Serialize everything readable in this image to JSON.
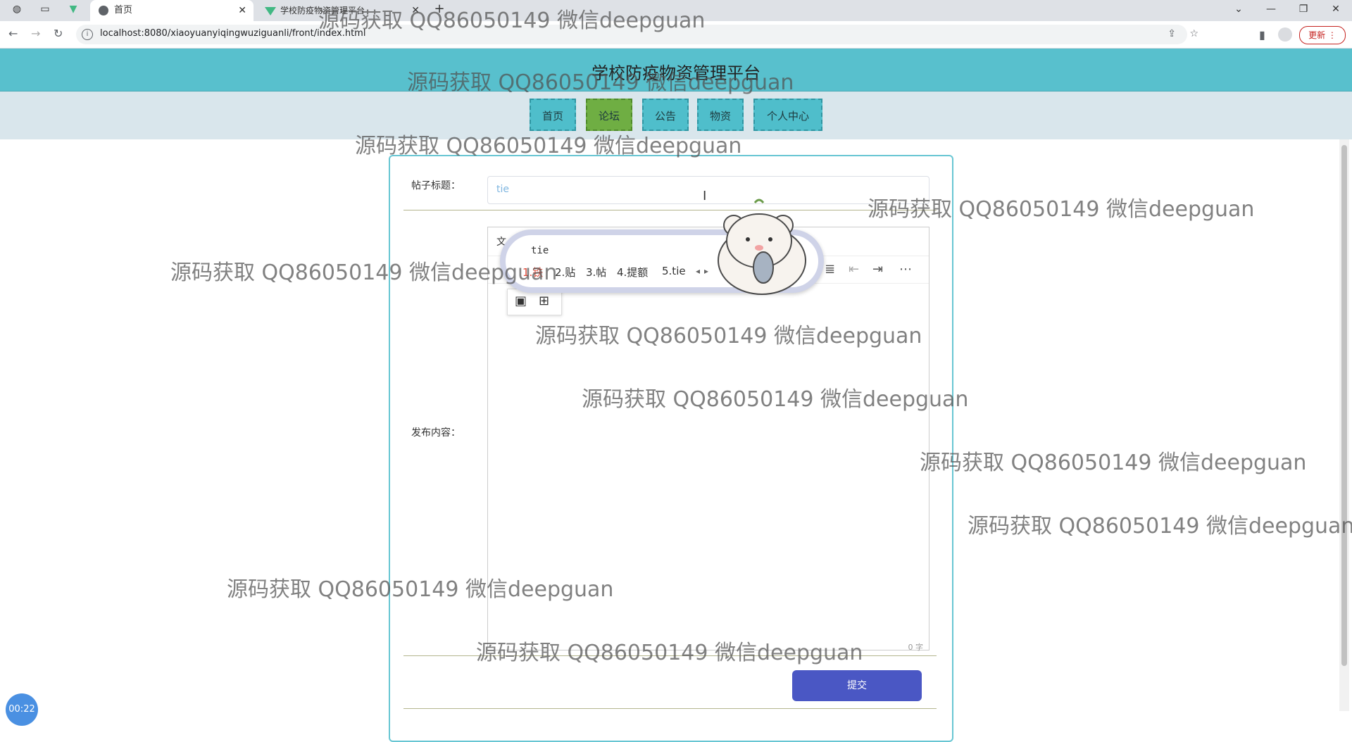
{
  "browser": {
    "tabs": [
      {
        "label": "首页"
      },
      {
        "label": "学校防疫物资管理平台"
      }
    ],
    "url": "localhost:8080/xiaoyuanyiqingwuziguanli/front/index.html",
    "update_button": "更新"
  },
  "site": {
    "title": "学校防疫物资管理平台",
    "nav": [
      {
        "label": "首页",
        "active": false
      },
      {
        "label": "论坛",
        "active": true
      },
      {
        "label": "公告",
        "active": false
      },
      {
        "label": "物资",
        "active": false
      },
      {
        "label": "个人中心",
        "active": false
      }
    ]
  },
  "form": {
    "title_label": "帖子标题：",
    "title_value": "tie",
    "content_label": "发布内容：",
    "editor_mode": "文",
    "word_count": "0 字",
    "submit_label": "提交"
  },
  "ime": {
    "input": "tie",
    "candidates": [
      "1.铁",
      "2.贴",
      "3.帖",
      "4.提额",
      "5.tie"
    ]
  },
  "timer": "00:22",
  "watermark": "源码获取 QQ86050149 微信deepguan",
  "colors": {
    "header": "#58c0cd",
    "nav_active": "#6fae43",
    "submit": "#4a57c4"
  }
}
